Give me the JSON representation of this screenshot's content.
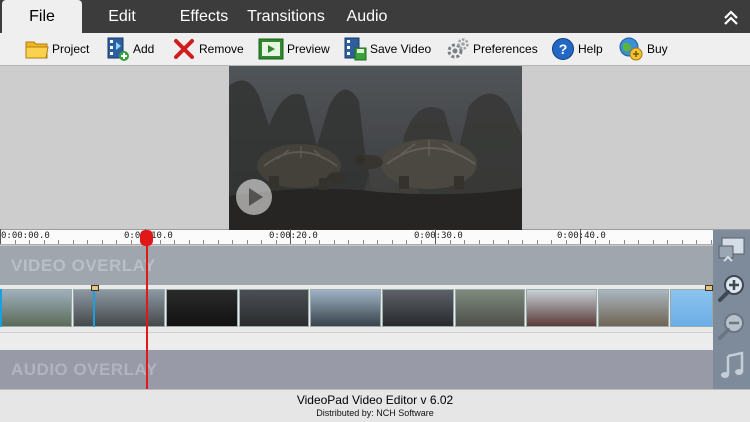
{
  "menu": {
    "tabs": [
      {
        "label": "File",
        "active": true
      },
      {
        "label": "Edit",
        "active": false
      },
      {
        "label": "Effects",
        "active": false
      },
      {
        "label": "Transitions",
        "active": false
      },
      {
        "label": "Audio",
        "active": false
      }
    ],
    "collapse_icon": "double-chevron-up-icon"
  },
  "toolbar": {
    "items": [
      {
        "label": "Project",
        "icon": "folder-icon"
      },
      {
        "label": "Add",
        "icon": "add-media-icon"
      },
      {
        "label": "Remove",
        "icon": "remove-x-icon"
      },
      {
        "label": "Preview",
        "icon": "preview-play-icon"
      },
      {
        "label": "Save Video",
        "icon": "save-video-icon"
      },
      {
        "label": "Preferences",
        "icon": "gear-icon"
      },
      {
        "label": "Help",
        "icon": "help-icon"
      },
      {
        "label": "Buy",
        "icon": "buy-globe-icon"
      }
    ]
  },
  "preview": {
    "play_icon": "play-circle-icon"
  },
  "timeline": {
    "ruler_labels": [
      "0:00:00.0",
      "0:00:10.0",
      "0:00:20.0",
      "0:00:30.0",
      "0:00:40.0"
    ],
    "video_overlay_label": "VIDEO OVERLAY",
    "audio_overlay_label": "AUDIO OVERLAY",
    "clip_count": 10
  },
  "side_panel": {
    "icons": [
      "overlay-window-icon",
      "zoom-in-icon",
      "zoom-out-icon",
      "music-note-icon"
    ]
  },
  "colors": {
    "menu_bg": "#3c3c3c",
    "playhead": "#e01818",
    "clip_edge": "#1a9fe0"
  },
  "status": {
    "title": "VideoPad Video Editor v 6.02",
    "subtitle": "Distributed by: NCH Software"
  }
}
